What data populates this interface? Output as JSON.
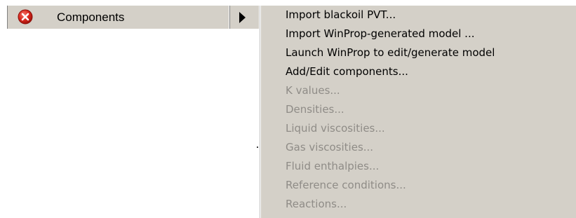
{
  "tree": {
    "item_label": "Components",
    "status_icon": "error-icon",
    "submenu_icon": "submenu-arrow-icon"
  },
  "menu": {
    "items": [
      {
        "label": "Import blackoil PVT...",
        "enabled": true
      },
      {
        "label": "Import WinProp-generated model ...",
        "enabled": true
      },
      {
        "label": "Launch WinProp to edit/generate model",
        "enabled": true
      },
      {
        "label": "Add/Edit components...",
        "enabled": true
      },
      {
        "label": "K values...",
        "enabled": false
      },
      {
        "label": "Densities...",
        "enabled": false
      },
      {
        "label": "Liquid viscosities...",
        "enabled": false
      },
      {
        "label": "Gas viscosities...",
        "enabled": false
      },
      {
        "label": "Fluid enthalpies...",
        "enabled": false
      },
      {
        "label": "Reference conditions...",
        "enabled": false
      },
      {
        "label": "Reactions...",
        "enabled": false
      }
    ]
  },
  "colors": {
    "menu_bg": "#d4d0c8",
    "disabled_text": "#8f8c87",
    "error_red": "#d9261c"
  }
}
